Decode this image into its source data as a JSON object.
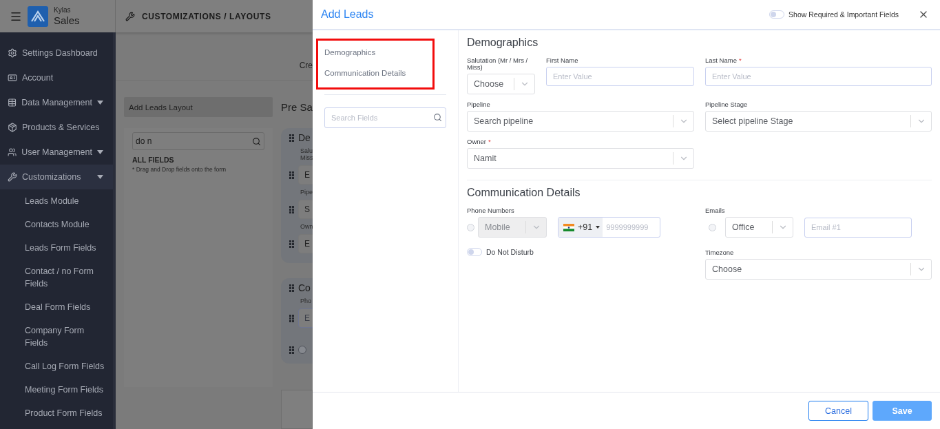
{
  "app_header": {
    "brand_small": "Kylas",
    "brand": "Sales",
    "page_title": "CUSTOMIZATIONS / LAYOUTS"
  },
  "sidebar": {
    "items": [
      {
        "label": "Settings Dashboard",
        "kind": "link",
        "selected": false
      },
      {
        "label": "Account",
        "kind": "link",
        "selected": false
      },
      {
        "label": "Data Management",
        "kind": "group",
        "selected": false
      },
      {
        "label": "Products & Services",
        "kind": "link",
        "selected": false
      },
      {
        "label": "User Management",
        "kind": "group",
        "selected": false
      },
      {
        "label": "Customizations",
        "kind": "group",
        "selected": true,
        "children": [
          {
            "label": "Leads Module",
            "selected": false
          },
          {
            "label": "Contacts Module",
            "selected": false
          },
          {
            "label": "Leads Form Fields",
            "selected": false
          },
          {
            "label": "Contact / no Form Fields",
            "selected": false
          },
          {
            "label": "Deal Form Fields",
            "selected": false
          },
          {
            "label": "Company Form Fields",
            "selected": false
          },
          {
            "label": "Call Log Form Fields",
            "selected": false
          },
          {
            "label": "Meeting Form Fields",
            "selected": false
          },
          {
            "label": "Product Form Fields",
            "selected": false
          }
        ]
      }
    ]
  },
  "content": {
    "tab_partial": "Cre",
    "layout_name": "Add Leads Layout",
    "preview_title": "Pre Sa",
    "field_search": {
      "value": "do n"
    },
    "all_fields_heading": "ALL FIELDS",
    "hint": "* Drag and Drop fields onto the form",
    "preview_cards": [
      {
        "items": [
          {
            "kind": "title",
            "text": "De"
          },
          {
            "kind": "label",
            "lines": [
              "Salu",
              "Miss"
            ]
          },
          {
            "kind": "field",
            "text": "E"
          },
          {
            "kind": "label",
            "lines": [
              "Pipe"
            ]
          },
          {
            "kind": "field",
            "text": "S"
          },
          {
            "kind": "label",
            "lines": [
              "Own"
            ]
          },
          {
            "kind": "field",
            "text": "E"
          }
        ]
      },
      {
        "items": [
          {
            "kind": "title",
            "text": "Co"
          },
          {
            "kind": "label",
            "lines": [
              "Pho"
            ]
          },
          {
            "kind": "input",
            "text": "E"
          },
          {
            "kind": "radio",
            "selected": false
          }
        ]
      }
    ]
  },
  "modal": {
    "title": "Add Leads",
    "required_mark": "*",
    "required_toggle": {
      "label": "Show Required & Important Fields",
      "on": false
    },
    "nav": {
      "highlighted": true,
      "items": [
        {
          "label": "Demographics"
        },
        {
          "label": "Communication Details"
        }
      ],
      "search": {
        "placeholder": "Search Fields"
      }
    },
    "sections": [
      {
        "title": "Demographics",
        "fields": [
          {
            "kind": "select",
            "label": "Salutation (Mr / Mrs / Miss)",
            "required": false,
            "placeholder": "Choose"
          },
          {
            "kind": "text",
            "label": "First Name",
            "required": false,
            "placeholder": "Enter Value"
          },
          {
            "kind": "text",
            "label": "Last Name",
            "required": true,
            "placeholder": "Enter Value"
          },
          {
            "kind": "select",
            "label": "Pipeline",
            "required": false,
            "placeholder": "Search pipeline"
          },
          {
            "kind": "select",
            "label": "Pipeline Stage",
            "required": false,
            "placeholder": "Select pipeline Stage"
          },
          {
            "kind": "select",
            "label": "Owner",
            "required": true,
            "value": "Namit"
          }
        ]
      },
      {
        "title": "Communication Details",
        "fields": [
          {
            "kind": "phone",
            "label": "Phone Numbers",
            "required": false,
            "primary": false,
            "type_select": {
              "value": "Mobile",
              "disabled": true
            },
            "country_code": "+91",
            "placeholder": "9999999999"
          },
          {
            "kind": "email",
            "label": "Emails",
            "required": false,
            "primary": false,
            "type_select": {
              "value": "Office",
              "disabled": false
            },
            "placeholder": "Email #1"
          },
          {
            "kind": "toggle",
            "label": "Do Not Disturb",
            "on": false
          },
          {
            "kind": "select",
            "label": "Timezone",
            "required": false,
            "placeholder": "Choose"
          }
        ]
      }
    ]
  },
  "footer": {
    "buttons": [
      {
        "label": "Cancel",
        "kind": "secondary"
      },
      {
        "label": "Save",
        "kind": "primary"
      }
    ]
  }
}
